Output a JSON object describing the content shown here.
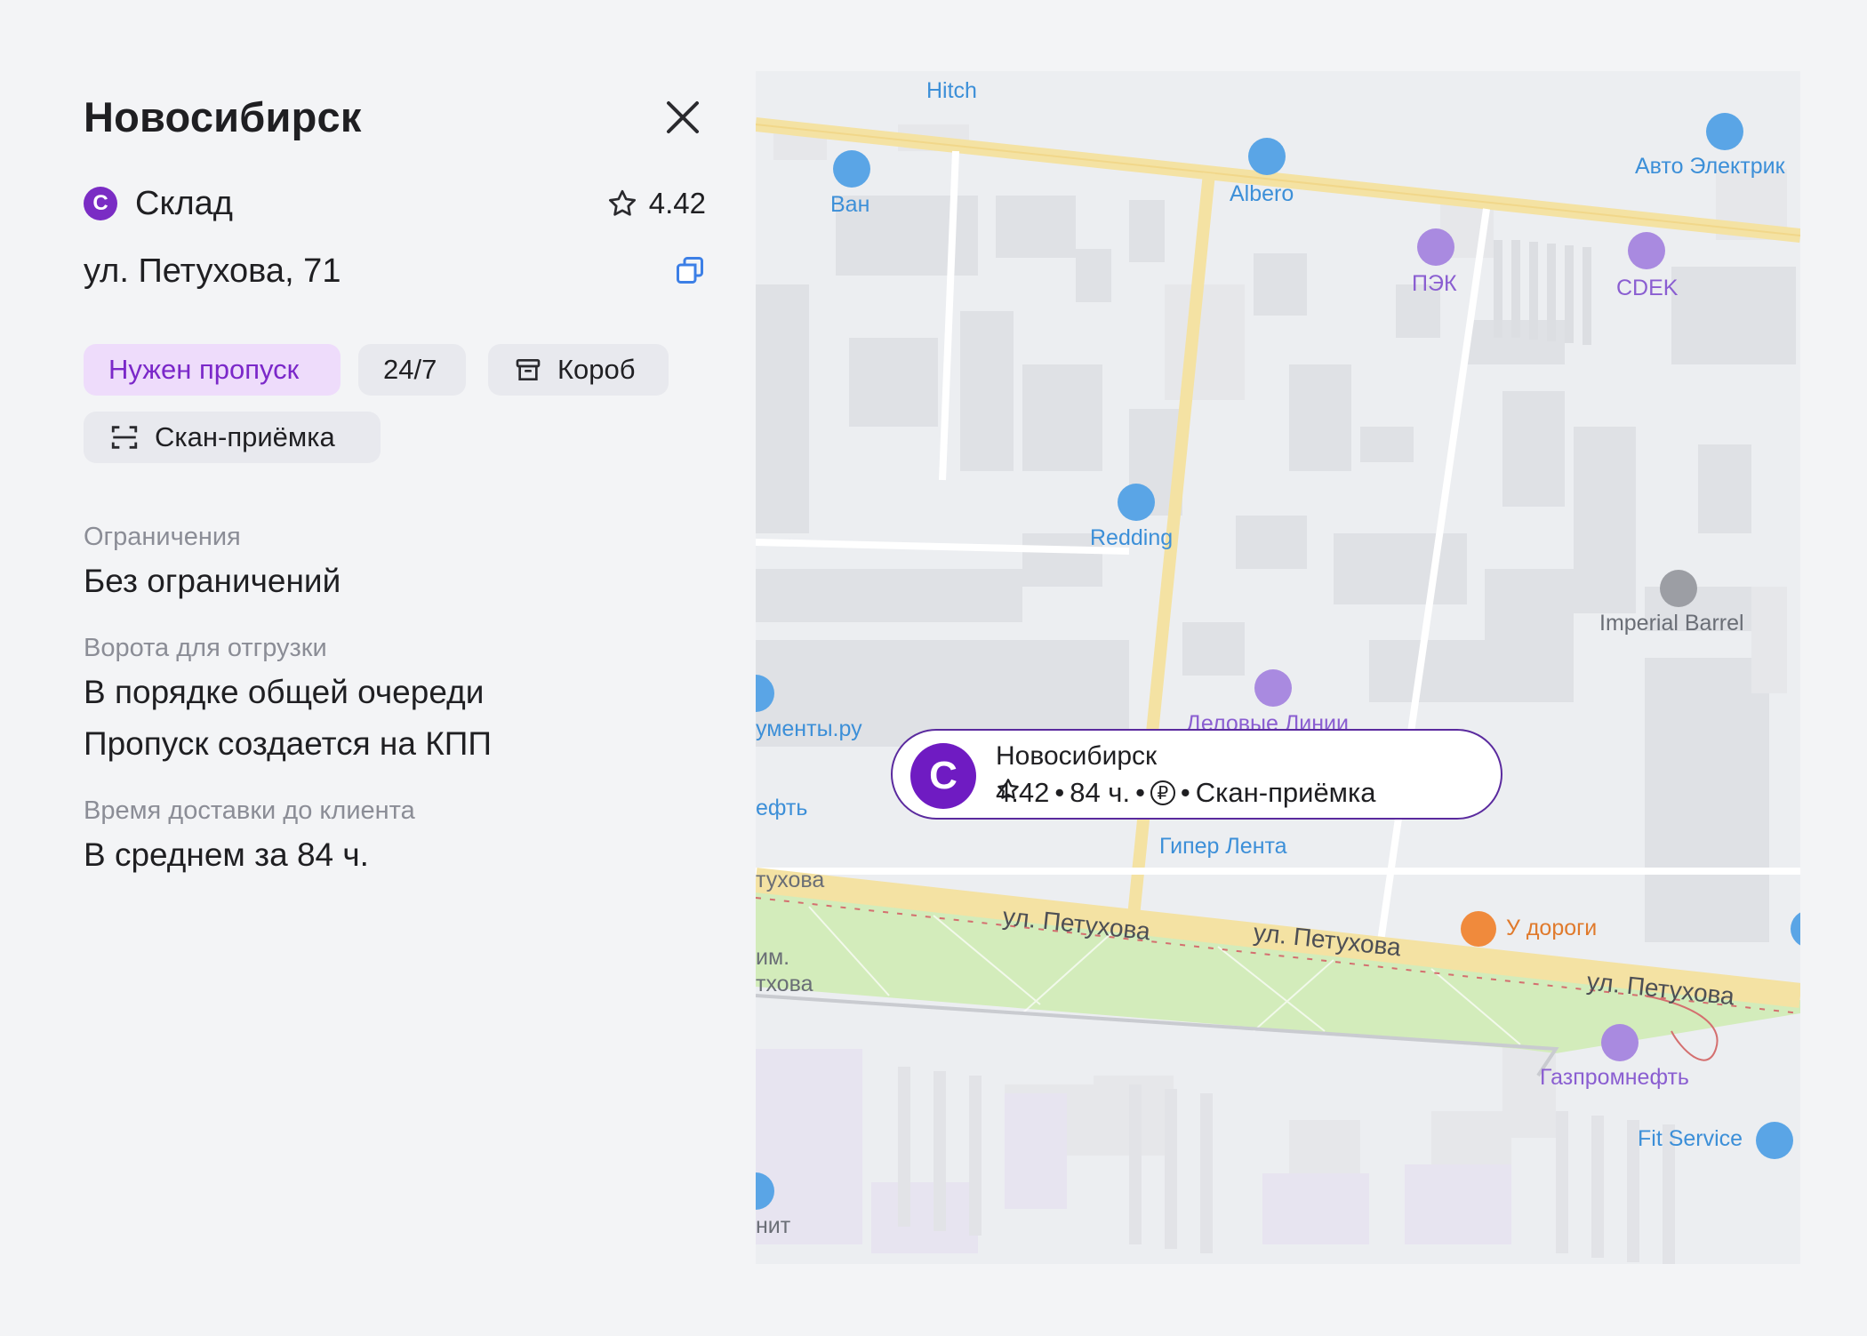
{
  "panel": {
    "title": "Новосибирск",
    "type_badge": "С",
    "type_label": "Склад",
    "rating": "4.42",
    "address": "ул. Петухова, 71",
    "chips": {
      "pass": "Нужен пропуск",
      "hours": "24/7",
      "box": "Короб",
      "scan": "Скан-приёмка"
    },
    "sections": {
      "restrictions_label": "Ограничения",
      "restrictions_value": "Без ограничений",
      "gates_label": "Ворота для отгрузки",
      "gates_value_1": "В порядке общей очереди",
      "gates_value_2": "Пропуск создается на КПП",
      "delivery_label": "Время доставки до клиента",
      "delivery_value": "В среднем за 84 ч."
    }
  },
  "map": {
    "pois": {
      "hitch": "Hitch",
      "van": "Ван",
      "albero": "Albero",
      "auto": "Авто Электрик",
      "pek": "ПЭК",
      "cdek": "CDEK",
      "redding": "Redding",
      "imperial": "Imperial Barrel",
      "menty": "ументы.ру",
      "lines": "Деловые Линии",
      "neft": "ефть",
      "lenta": "Гипер Лента",
      "udorogi": "У дороги",
      "gazprom": "Газпромнефть",
      "fit": "Fit Service",
      "ukhova": "тухова",
      "im": "им.",
      "ukhova2": "тхова",
      "nit": "нит"
    },
    "streets": {
      "s1": "ул. Петухова",
      "s2": "ул. Петухова",
      "s3": "ул. Петухова"
    },
    "popup": {
      "badge": "С",
      "title": "Новосибирск",
      "rating": "4.42",
      "sep1": "•",
      "time": "84 ч.",
      "sep2": "•",
      "currency": "₽",
      "sep3": "•",
      "feature": "Скан-приёмка"
    }
  },
  "colors": {
    "accent": "#7a2cc4",
    "chip_pass_bg": "#eedcfb",
    "map_road": "#f6e3a0",
    "map_park": "#cfecb3"
  }
}
